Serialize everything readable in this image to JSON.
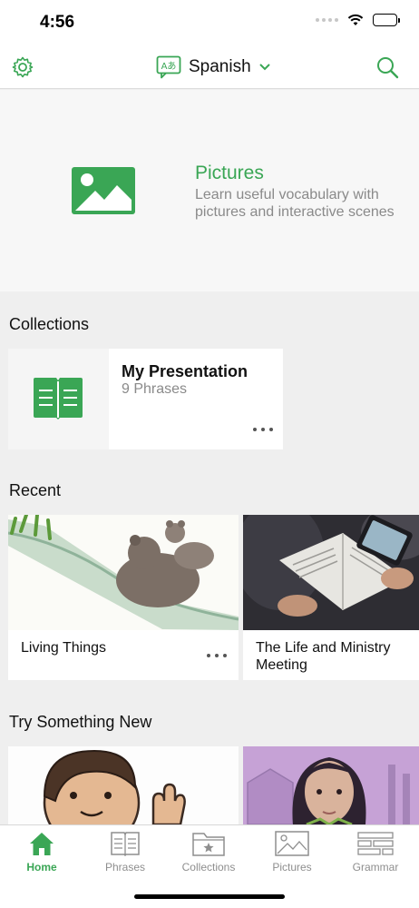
{
  "status": {
    "time": "4:56"
  },
  "header": {
    "language": "Spanish",
    "language_icon_label": "Aあ"
  },
  "hero": {
    "title": "Pictures",
    "description": "Learn useful vocabulary with pictures and interactive scenes"
  },
  "collections": {
    "heading": "Collections",
    "items": [
      {
        "name": "My Presentation",
        "count": "9 Phrases"
      }
    ]
  },
  "recent": {
    "heading": "Recent",
    "items": [
      {
        "title": "Living Things"
      },
      {
        "title": "The Life and Ministry Meeting"
      }
    ]
  },
  "try_new": {
    "heading": "Try Something New"
  },
  "tabs": [
    {
      "label": "Home",
      "icon": "home-icon",
      "active": true
    },
    {
      "label": "Phrases",
      "icon": "book-icon",
      "active": false
    },
    {
      "label": "Collections",
      "icon": "folder-star-icon",
      "active": false
    },
    {
      "label": "Pictures",
      "icon": "picture-icon",
      "active": false
    },
    {
      "label": "Grammar",
      "icon": "grammar-icon",
      "active": false
    }
  ],
  "colors": {
    "accent": "#3aa655",
    "muted": "#8a8a8a",
    "background": "#efefef"
  }
}
